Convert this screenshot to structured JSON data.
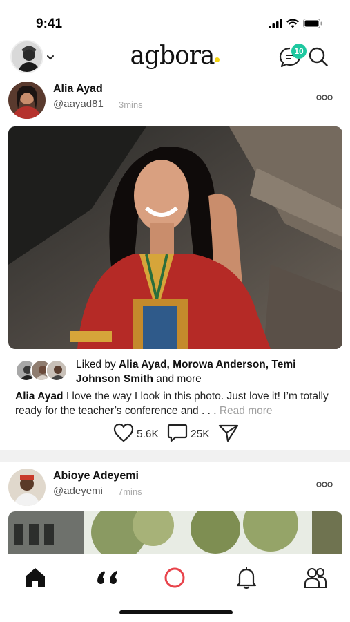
{
  "status_bar": {
    "time": "9:41"
  },
  "header": {
    "brand": "agbora",
    "brand_accent": "#f3d313",
    "messages_badge": "10",
    "badge_color": "#1ec8a0",
    "icons": [
      "chevron-down-icon",
      "chat-icon",
      "search-icon"
    ]
  },
  "posts": [
    {
      "name": "Alia Ayad",
      "handle": "@aayad81",
      "time": "3mins",
      "liked_by_prefix": "Liked by",
      "liked_by_names": "Alia Ayad, Morowa Anderson, Temi Johnson Smith",
      "liked_by_suffix": "and more",
      "caption_author": "Alia Ayad",
      "caption_text": "I love the way I look in this photo. Just love it! I’m totally ready for the teacher’s conference and . . .",
      "read_more": "Read more",
      "likes_count": "5.6K",
      "comments_count": "25K"
    },
    {
      "name": "Abioye Adeyemi",
      "handle": "@adeyemi",
      "time": "7mins"
    }
  ],
  "bottom_nav": {
    "items": [
      "home-icon",
      "quote-icon",
      "create-icon",
      "bell-icon",
      "people-icon"
    ],
    "create_color": "#e8434b"
  }
}
